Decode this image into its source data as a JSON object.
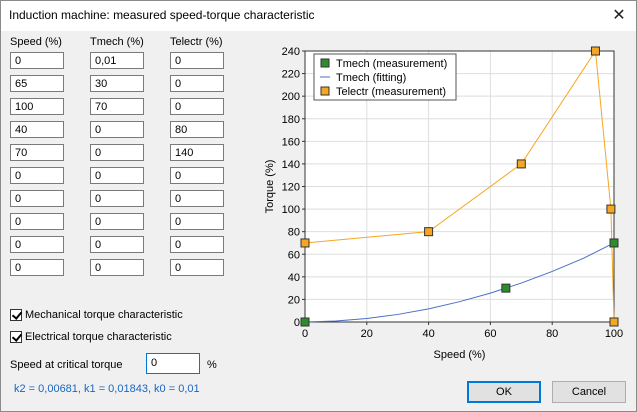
{
  "window": {
    "title": "Induction machine: measured speed-torque characteristic",
    "close": "✕"
  },
  "table": {
    "headers": [
      "Speed (%)",
      "Tmech (%)",
      "Telectr (%)"
    ],
    "rows": [
      [
        "0",
        "0,01",
        "0"
      ],
      [
        "65",
        "30",
        "0"
      ],
      [
        "100",
        "70",
        "0"
      ],
      [
        "40",
        "0",
        "80"
      ],
      [
        "70",
        "0",
        "140"
      ],
      [
        "0",
        "0",
        "0"
      ],
      [
        "0",
        "0",
        "0"
      ],
      [
        "0",
        "0",
        "0"
      ],
      [
        "0",
        "0",
        "0"
      ],
      [
        "0",
        "0",
        "0"
      ]
    ]
  },
  "options": {
    "mech_label": "Mechanical torque characteristic",
    "elec_label": "Electrical torque characteristic",
    "mech_checked": true,
    "elec_checked": true
  },
  "critical": {
    "label": "Speed at critical torque",
    "value": "0",
    "unit": "%"
  },
  "coefficients": "k2 = 0,00681, k1 = 0,01843, k0 = 0,01",
  "buttons": {
    "ok": "OK",
    "cancel": "Cancel"
  },
  "colors": {
    "tmech_meas": "#2e8b2e",
    "tmech_fit": "#4a6fc8",
    "telectr": "#f5a623"
  },
  "chart_data": {
    "type": "scatter",
    "xlabel": "Speed (%)",
    "ylabel": "Torque (%)",
    "xlim": [
      0,
      100
    ],
    "ylim": [
      0,
      240
    ],
    "xticks": [
      0,
      20,
      40,
      60,
      80,
      100
    ],
    "yticks": [
      0,
      20,
      40,
      60,
      80,
      100,
      120,
      140,
      160,
      180,
      200,
      220,
      240
    ],
    "grid": true,
    "legend_position": "top-left",
    "series": [
      {
        "name": "Tmech (measurement)",
        "kind": "markers",
        "color": "#2e8b2e",
        "points": [
          [
            0,
            0.01
          ],
          [
            65,
            30
          ],
          [
            100,
            70
          ]
        ]
      },
      {
        "name": "Tmech (fitting)",
        "kind": "line",
        "color": "#4a6fc8",
        "points": [
          [
            0,
            0.01
          ],
          [
            10,
            0.89
          ],
          [
            20,
            3.1
          ],
          [
            30,
            6.7
          ],
          [
            40,
            11.6
          ],
          [
            50,
            18.0
          ],
          [
            60,
            25.6
          ],
          [
            70,
            34.5
          ],
          [
            80,
            44.8
          ],
          [
            90,
            56.3
          ],
          [
            100,
            70.0
          ]
        ]
      },
      {
        "name": "Telectr (measurement)",
        "kind": "line+markers",
        "color": "#f5a623",
        "points": [
          [
            0,
            70
          ],
          [
            40,
            80
          ],
          [
            70,
            140
          ],
          [
            94,
            240
          ],
          [
            99,
            100
          ],
          [
            100,
            0
          ]
        ]
      }
    ]
  }
}
